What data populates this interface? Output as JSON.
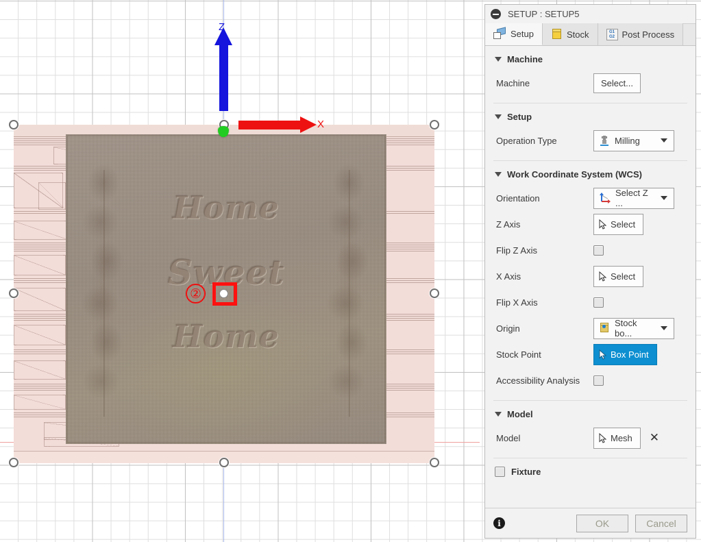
{
  "viewport": {
    "axes": {
      "z_label": "Z",
      "x_label": "X",
      "z_color": "#1515dd",
      "x_color": "#ee1111",
      "origin_color": "#22cc22"
    },
    "annotation": {
      "step_number": "②",
      "highlight_color": "#ff1111"
    },
    "model": {
      "carved_line_1": "Home",
      "carved_line_2": "Sweet",
      "carved_line_3": "Home"
    }
  },
  "panel": {
    "header": {
      "title": "SETUP : SETUP5"
    },
    "tabs": [
      {
        "label": "Setup",
        "icon": "setup-box-icon",
        "active": true
      },
      {
        "label": "Stock",
        "icon": "stock-box-icon",
        "active": false
      },
      {
        "label": "Post Process",
        "icon": "g-code-icon",
        "active": false
      }
    ],
    "machine_section": {
      "title": "Machine",
      "machine_label": "Machine",
      "machine_button": "Select..."
    },
    "setup_section": {
      "title": "Setup",
      "operation_type_label": "Operation Type",
      "operation_type_value": "Milling"
    },
    "wcs_section": {
      "title": "Work Coordinate System (WCS)",
      "orientation_label": "Orientation",
      "orientation_value": "Select Z ...",
      "z_axis_label": "Z Axis",
      "z_axis_button": "Select",
      "flip_z_label": "Flip Z Axis",
      "x_axis_label": "X Axis",
      "x_axis_button": "Select",
      "flip_x_label": "Flip X Axis",
      "origin_label": "Origin",
      "origin_value": "Stock bo...",
      "stock_point_label": "Stock Point",
      "stock_point_button": "Box Point",
      "stock_point_active_color": "#0d8fd1",
      "accessibility_label": "Accessibility Analysis"
    },
    "model_section": {
      "title": "Model",
      "model_label": "Model",
      "model_button": "Mesh",
      "clear_icon": "✕"
    },
    "fixture_section": {
      "title": "Fixture"
    },
    "footer": {
      "info_icon": "i",
      "ok_label": "OK",
      "cancel_label": "Cancel"
    }
  }
}
